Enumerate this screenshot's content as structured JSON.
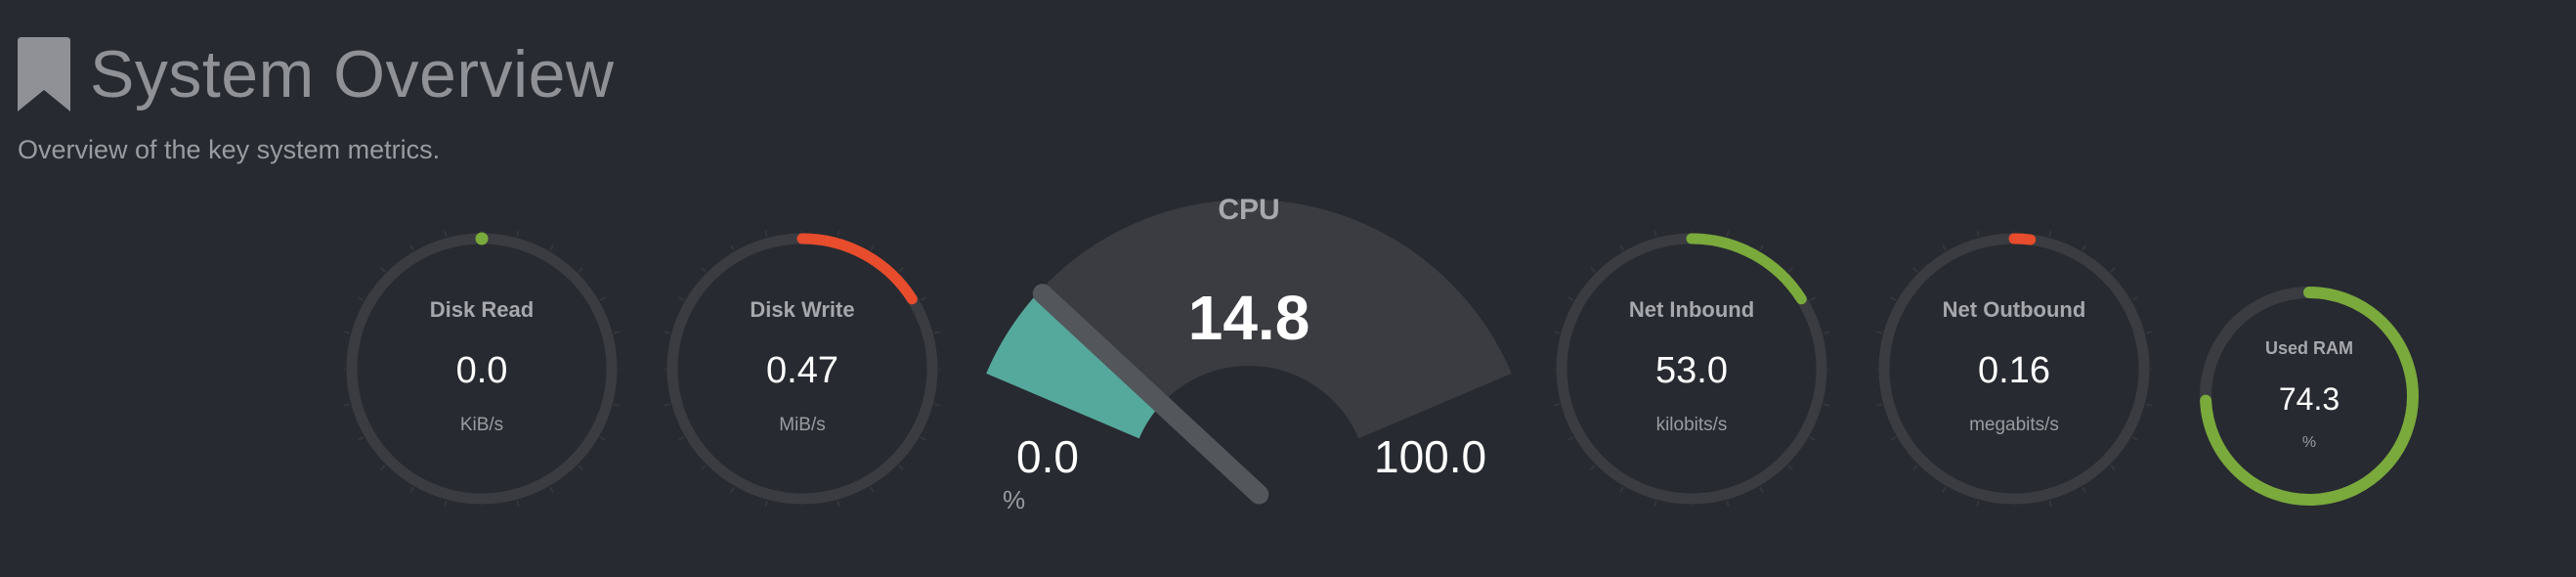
{
  "header": {
    "title": "System Overview",
    "subtitle": "Overview of the key system metrics."
  },
  "colors": {
    "background": "#272a30",
    "track": "#3a3c41",
    "green": "#7aa93c",
    "red": "#e74c2c",
    "teal": "#55a89c"
  },
  "gauges": {
    "disk_read": {
      "title": "Disk Read",
      "value": "0.0",
      "unit": "KiB/s",
      "fraction": 0.0,
      "color": "green"
    },
    "disk_write": {
      "title": "Disk Write",
      "value": "0.47",
      "unit": "MiB/s",
      "fraction": 0.16,
      "color": "red"
    },
    "net_inbound": {
      "title": "Net Inbound",
      "value": "53.0",
      "unit": "kilobits/s",
      "fraction": 0.16,
      "color": "green"
    },
    "net_outbound": {
      "title": "Net Outbound",
      "value": "0.16",
      "unit": "megabits/s",
      "fraction": 0.02,
      "color": "red"
    },
    "used_ram": {
      "title": "Used RAM",
      "value": "74.3",
      "unit": "%",
      "fraction": 0.743,
      "color": "green"
    }
  },
  "cpu": {
    "title": "CPU",
    "value": "14.8",
    "min": "0.0",
    "max": "100.0",
    "unit": "%",
    "percent": 14.8
  }
}
